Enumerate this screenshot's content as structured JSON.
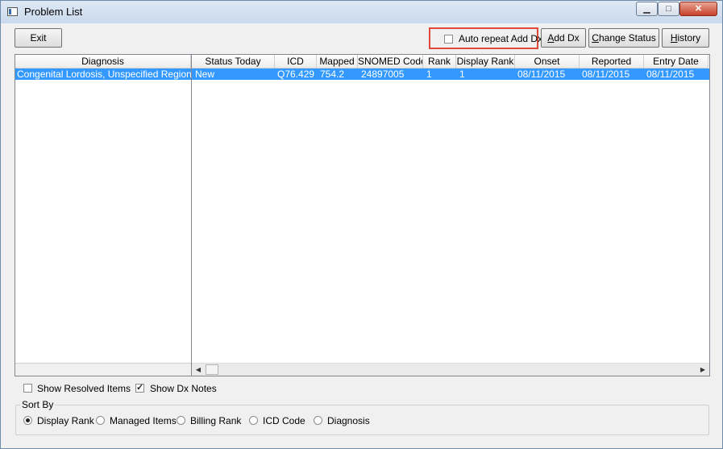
{
  "window": {
    "title": "Problem List",
    "minimize_glyph": "▁",
    "maximize_glyph": "□",
    "close_glyph": "✕"
  },
  "toolbar": {
    "exit_label": "Exit",
    "auto_repeat_label": "Auto repeat Add Dx",
    "auto_repeat_checked": false,
    "add_dx_label": "Add Dx",
    "change_status_label": "Change Status",
    "history_label": "History",
    "highlight_color": "#e0493a"
  },
  "diagnosis_list": {
    "header": "Diagnosis",
    "rows": [
      {
        "diagnosis": "Congenital Lordosis, Unspecified Region",
        "selected": true
      }
    ]
  },
  "detail_table": {
    "columns": [
      "Status Today",
      "ICD",
      "Mapped",
      "SNOMED Code",
      "Rank",
      "Display Rank",
      "Onset",
      "Reported",
      "Entry Date"
    ],
    "rows": [
      {
        "status_today": "New",
        "icd": "Q76.429",
        "mapped": "754.2",
        "snomed": "24897005",
        "rank": "1",
        "display_rank": "1",
        "onset": "08/11/2015",
        "reported": "08/11/2015",
        "entry_date": "08/11/2015"
      }
    ],
    "selection_color": "#3399ff"
  },
  "scrollbar": {
    "left_arrow": "◀",
    "right_arrow": "▶"
  },
  "options": {
    "show_resolved_label": "Show Resolved Items",
    "show_resolved_checked": false,
    "show_dx_notes_label": "Show Dx Notes",
    "show_dx_notes_checked": true
  },
  "sort_by": {
    "label": "Sort By",
    "options": [
      {
        "label": "Display Rank",
        "selected": true
      },
      {
        "label": "Managed Items",
        "selected": false
      },
      {
        "label": "Billing Rank",
        "selected": false
      },
      {
        "label": "ICD Code",
        "selected": false
      },
      {
        "label": "Diagnosis",
        "selected": false
      }
    ]
  }
}
